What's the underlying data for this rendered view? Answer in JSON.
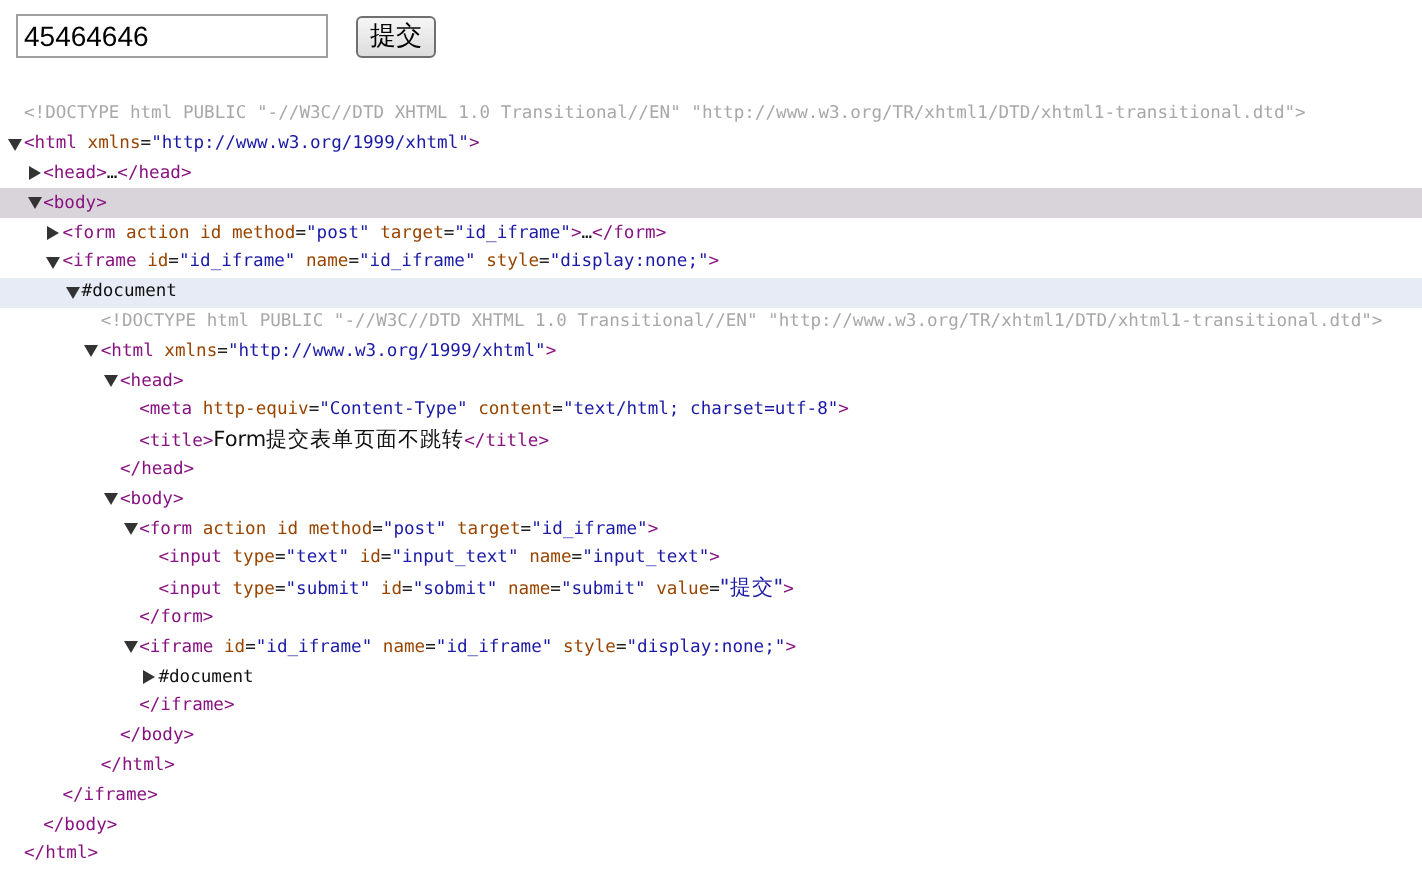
{
  "form": {
    "value": "45464646",
    "submit_label": "提交"
  },
  "dom": [
    {
      "kind": "doctype",
      "open": "<!DOCTYPE html PUBLIC \"-//W3C//DTD XHTML 1.0 Transitional//EN\" \"http://www.w3.org/TR/xhtml1/DTD/xhtml1-transitional.dtd\">",
      "selected": false,
      "hovered": false
    },
    {
      "kind": "element",
      "open": "<html xmlns=\"http://www.w3.org/1999/xhtml\">",
      "close": "</html>",
      "expanded": true,
      "selected": false,
      "hovered": false,
      "children": [
        {
          "kind": "element",
          "open": "<head>",
          "collapsed_text": "…",
          "close": "</head>",
          "expanded": false,
          "selected": false,
          "hovered": false
        },
        {
          "kind": "element",
          "open": "<body>",
          "close": "</body>",
          "expanded": true,
          "selected": true,
          "hovered": false,
          "children": [
            {
              "kind": "element",
              "open": "<form action id method=\"post\" target=\"id_iframe\">",
              "collapsed_text": "…",
              "close": "</form>",
              "expanded": false,
              "selected": false,
              "hovered": false
            },
            {
              "kind": "element",
              "open": "<iframe id=\"id_iframe\" name=\"id_iframe\" style=\"display:none;\">",
              "close": "</iframe>",
              "expanded": true,
              "selected": false,
              "hovered": false,
              "children": [
                {
                  "kind": "document",
                  "open": "#document",
                  "expanded": true,
                  "selected": false,
                  "hovered": true,
                  "children": [
                    {
                      "kind": "doctype",
                      "open": "<!DOCTYPE html PUBLIC \"-//W3C//DTD XHTML 1.0 Transitional//EN\" \"http://www.w3.org/TR/xhtml1/DTD/xhtml1-transitional.dtd\">",
                      "selected": false,
                      "hovered": false
                    },
                    {
                      "kind": "element",
                      "open": "<html xmlns=\"http://www.w3.org/1999/xhtml\">",
                      "close": "</html>",
                      "expanded": true,
                      "selected": false,
                      "hovered": false,
                      "children": [
                        {
                          "kind": "element",
                          "open": "<head>",
                          "close": "</head>",
                          "expanded": true,
                          "selected": false,
                          "hovered": false,
                          "children": [
                            {
                              "kind": "element",
                              "open": "<meta http-equiv=\"Content-Type\" content=\"text/html; charset=utf-8\">",
                              "selected": false,
                              "hovered": false
                            },
                            {
                              "kind": "element",
                              "open": "<title>",
                              "text": "Form提交表单页面不跳转",
                              "close": "</title>",
                              "selected": false,
                              "hovered": false
                            }
                          ]
                        },
                        {
                          "kind": "element",
                          "open": "<body>",
                          "close": "</body>",
                          "expanded": true,
                          "selected": false,
                          "hovered": false,
                          "children": [
                            {
                              "kind": "element",
                              "open": "<form action id method=\"post\" target=\"id_iframe\">",
                              "close": "</form>",
                              "expanded": true,
                              "selected": false,
                              "hovered": false,
                              "children": [
                                {
                                  "kind": "element",
                                  "open": "<input type=\"text\" id=\"input_text\" name=\"input_text\">",
                                  "selected": false,
                                  "hovered": false
                                },
                                {
                                  "kind": "element",
                                  "open": "<input type=\"submit\" id=\"sobmit\" name=\"submit\" value=\"提交\">",
                                  "selected": false,
                                  "hovered": false
                                }
                              ]
                            },
                            {
                              "kind": "element",
                              "open": "<iframe id=\"id_iframe\" name=\"id_iframe\" style=\"display:none;\">",
                              "close": "</iframe>",
                              "expanded": true,
                              "selected": false,
                              "hovered": false,
                              "children": [
                                {
                                  "kind": "document",
                                  "open": "#document",
                                  "expanded": false,
                                  "selected": false,
                                  "hovered": false
                                }
                              ]
                            }
                          ]
                        }
                      ]
                    }
                  ]
                }
              ]
            }
          ]
        }
      ]
    }
  ]
}
